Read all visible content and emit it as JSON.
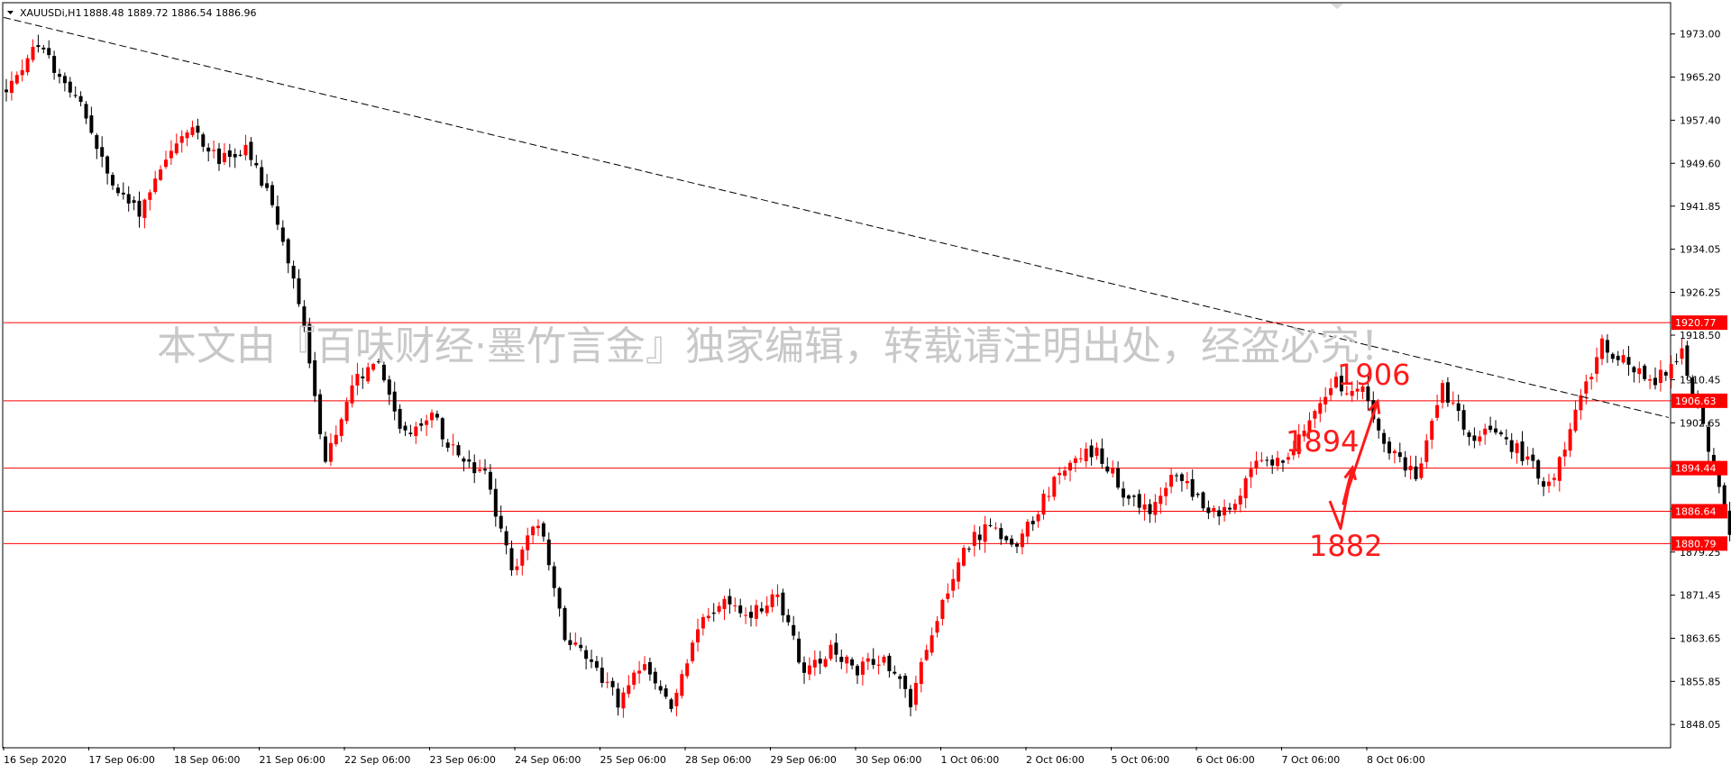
{
  "header": {
    "symbol": "XAUUSDi,H1",
    "ohlc": "1888.48 1889.72 1886.54 1886.96"
  },
  "watermark": "本文由『百味财经·墨竹言金』独家编辑，转载请注明出处，经盗必究！",
  "colors": {
    "background": "#ffffff",
    "candle_up": "#ff0000",
    "candle_down": "#000000",
    "level_line": "#ff0000",
    "trendline": "#000000",
    "annotation": "#ff1a1a"
  },
  "chart_data": {
    "type": "candlestick",
    "timeframe": "H1",
    "ylim": [
      1844.0,
      1978.5
    ],
    "y_ticks": [
      "1973.00",
      "1965.20",
      "1957.40",
      "1949.60",
      "1941.85",
      "1934.05",
      "1926.25",
      "1918.50",
      "1910.45",
      "1902.65",
      "1894.85",
      "1887.10",
      "1879.25",
      "1871.45",
      "1863.65",
      "1855.85",
      "1848.05"
    ],
    "x_labels": [
      "16 Sep 2020",
      "17 Sep 06:00",
      "18 Sep 06:00",
      "21 Sep 06:00",
      "22 Sep 06:00",
      "23 Sep 06:00",
      "24 Sep 06:00",
      "25 Sep 06:00",
      "28 Sep 06:00",
      "29 Sep 06:00",
      "30 Sep 06:00",
      "1 Oct 06:00",
      "2 Oct 06:00",
      "5 Oct 06:00",
      "6 Oct 06:00",
      "7 Oct 06:00",
      "8 Oct 06:00"
    ],
    "price_anchors": [
      1962,
      1971,
      1966,
      1958,
      1945,
      1941,
      1951,
      1956,
      1950,
      1952,
      1942,
      1925,
      1895,
      1910,
      1913,
      1900,
      1904,
      1896,
      1893,
      1876,
      1885,
      1864,
      1860,
      1852,
      1859,
      1851,
      1866,
      1870,
      1868,
      1872,
      1857,
      1862,
      1858,
      1860,
      1852,
      1868,
      1880,
      1884,
      1880,
      1889,
      1896,
      1898,
      1890,
      1886,
      1894,
      1888,
      1886,
      1895,
      1896,
      1903,
      1910,
      1908,
      1898,
      1893,
      1909,
      1900,
      1901,
      1897,
      1891,
      1904,
      1917,
      1913,
      1910,
      1915,
      1898,
      1878,
      1884,
      1894,
      1888,
      1889,
      1889,
      1887
    ],
    "levels": [
      {
        "value": 1920.77,
        "label": "1920.77"
      },
      {
        "value": 1906.63,
        "label": "1906.63"
      },
      {
        "value": 1894.44,
        "label": "1894.44"
      },
      {
        "value": 1886.64,
        "label": "1886.64"
      },
      {
        "value": 1880.79,
        "label": "1880.79"
      }
    ],
    "trendline": {
      "from_price": 1976.0,
      "to_price": 1903.6
    },
    "annotations": {
      "labels": [
        {
          "text": "1906",
          "price": 1909.5
        },
        {
          "text": "1894",
          "price": 1897.5
        },
        {
          "text": "1882",
          "price": 1878.6
        }
      ],
      "path_prices": [
        1888.5,
        1883.5,
        1894.5,
        1888.0,
        1906.5
      ]
    }
  }
}
